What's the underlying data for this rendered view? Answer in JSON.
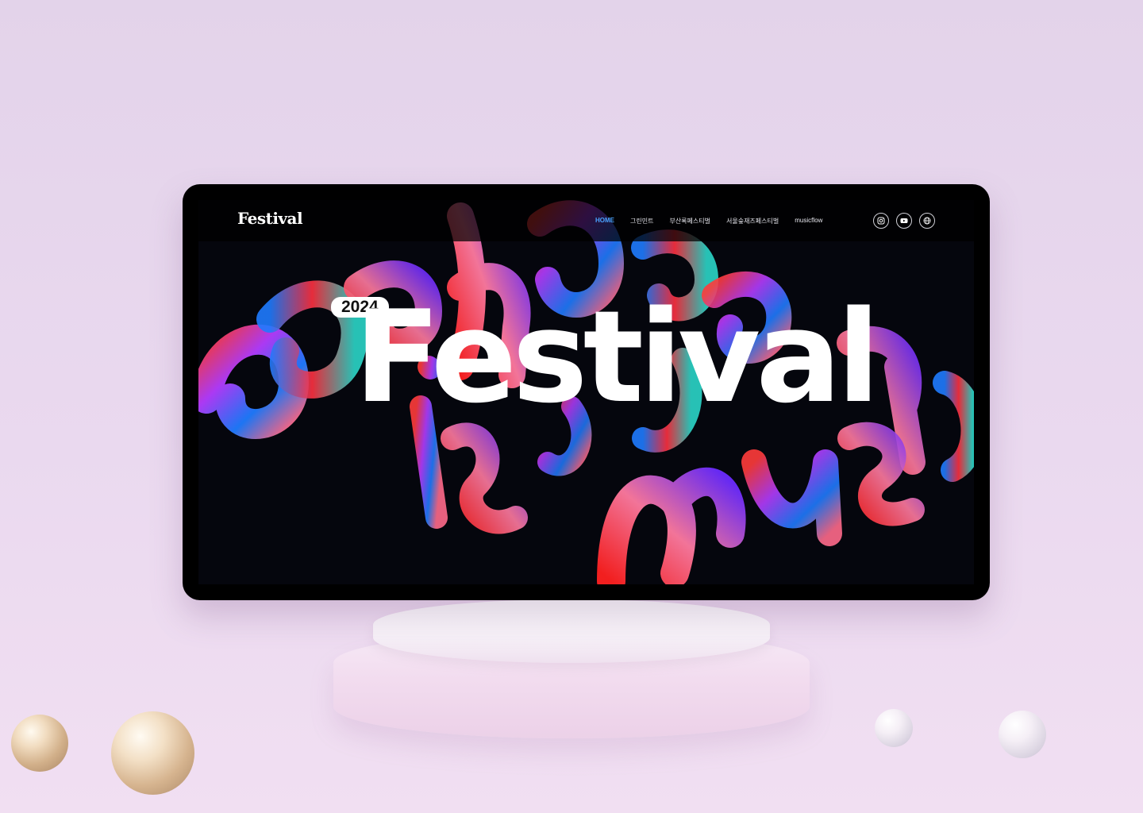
{
  "site": {
    "logo": "Festival",
    "nav": [
      {
        "label": "HOME",
        "active": true
      },
      {
        "label": "그린민트",
        "active": false
      },
      {
        "label": "부산록페스티벌",
        "active": false
      },
      {
        "label": "서울숲재즈페스티벌",
        "active": false
      },
      {
        "label": "musicflow",
        "active": false
      }
    ],
    "social_icons": [
      "instagram-icon",
      "youtube-icon",
      "globe-icon"
    ]
  },
  "hero": {
    "year_badge": "2024",
    "title": "Festival",
    "background_script": "Techno is the music"
  },
  "colors": {
    "page_bg": "#e6d5ec",
    "device_frame": "#000000",
    "screen_bg": "#05060d",
    "nav_active": "#4aa3ff",
    "hero_text": "#ffffff"
  }
}
